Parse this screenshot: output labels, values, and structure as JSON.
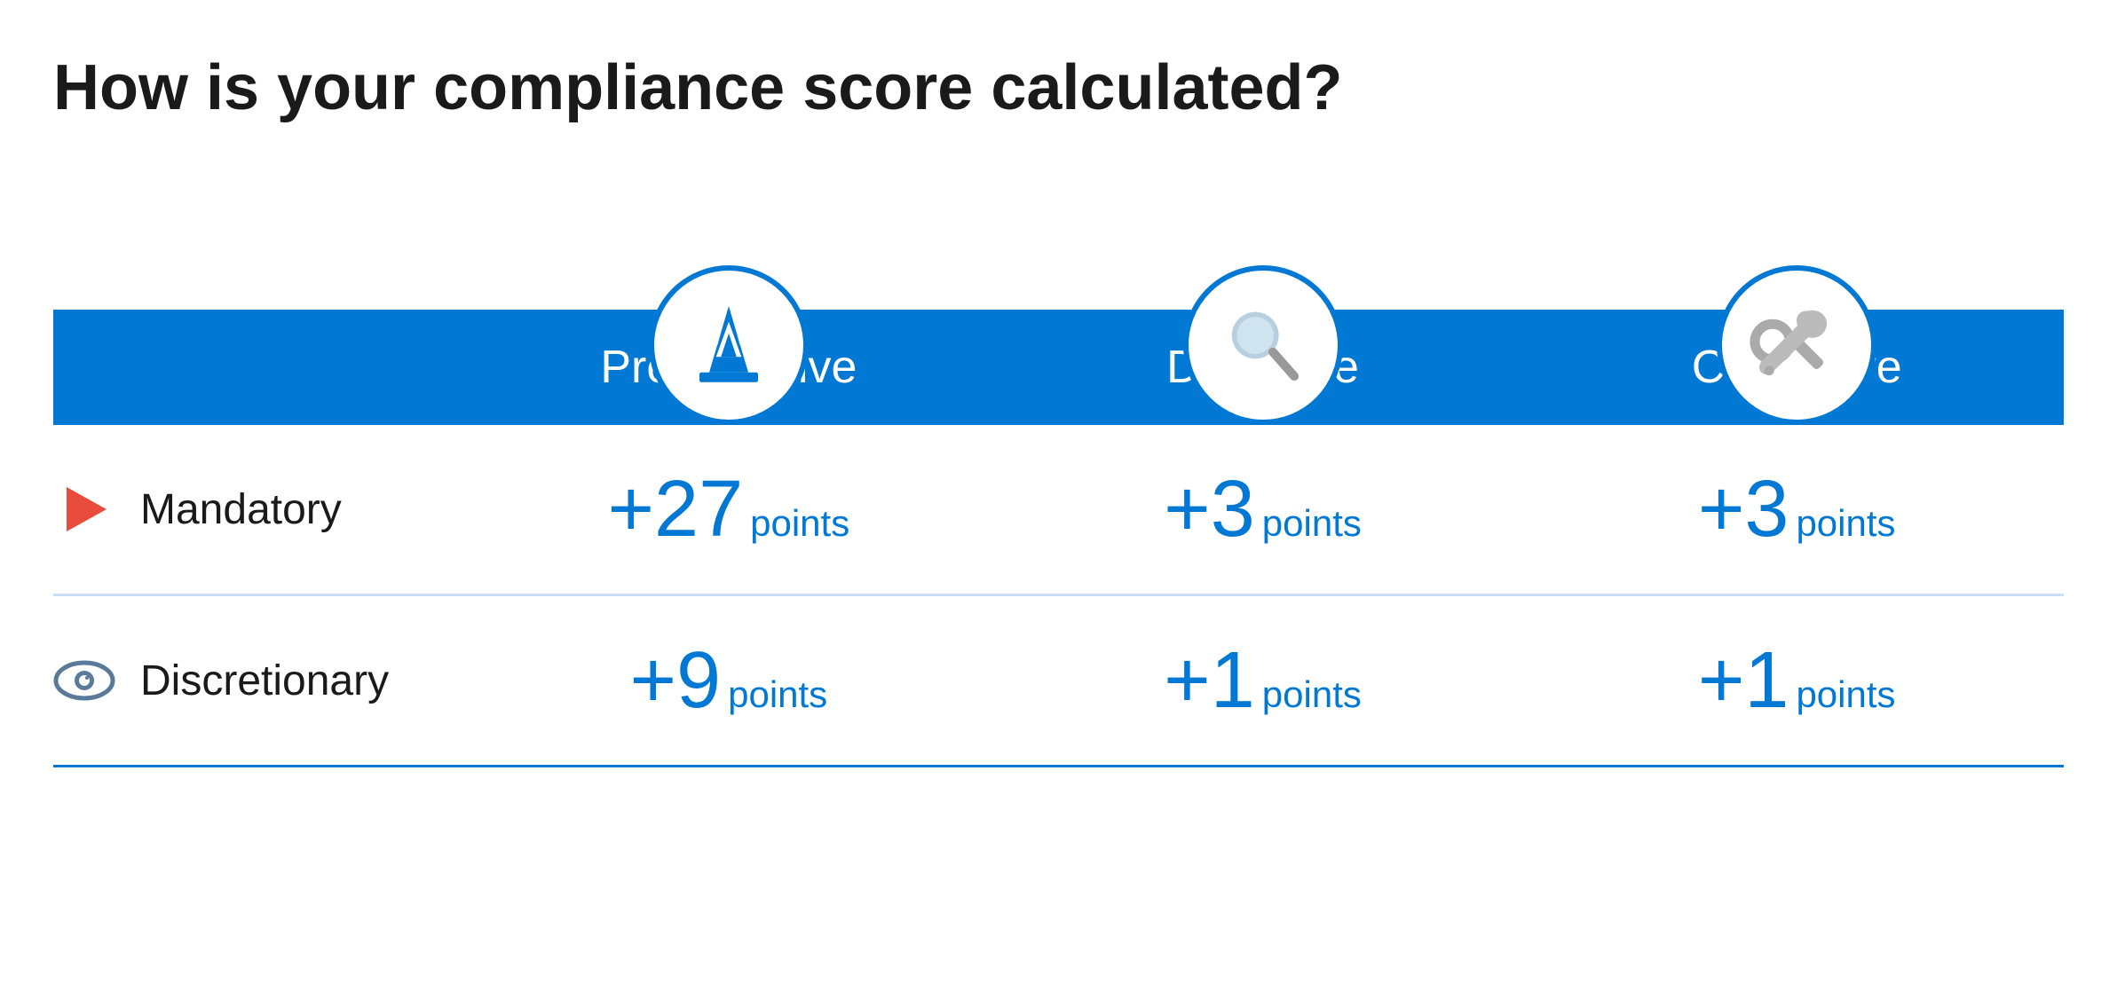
{
  "page": {
    "title": "How is your compliance score calculated?",
    "columns": [
      {
        "id": "preventative",
        "label": "Preventative",
        "icon": "cone"
      },
      {
        "id": "detective",
        "label": "Detective",
        "icon": "magnify"
      },
      {
        "id": "corrective",
        "label": "Corrective",
        "icon": "wrench"
      }
    ],
    "rows": [
      {
        "id": "mandatory",
        "label": "Mandatory",
        "icon": "flag",
        "cells": [
          {
            "prefix": "+",
            "number": "27",
            "unit": "points"
          },
          {
            "prefix": "+",
            "number": "3",
            "unit": "points"
          },
          {
            "prefix": "+",
            "number": "3",
            "unit": "points"
          }
        ]
      },
      {
        "id": "discretionary",
        "label": "Discretionary",
        "icon": "eye",
        "cells": [
          {
            "prefix": "+",
            "number": "9",
            "unit": "points"
          },
          {
            "prefix": "+",
            "number": "1",
            "unit": "points"
          },
          {
            "prefix": "+",
            "number": "1",
            "unit": "points"
          }
        ]
      }
    ],
    "colors": {
      "blue": "#0078d4",
      "text_dark": "#1a1a1a",
      "white": "#ffffff",
      "divider": "#c8dff5",
      "flag_red": "#e74c3c",
      "eye_color": "#5a7a9a"
    }
  }
}
